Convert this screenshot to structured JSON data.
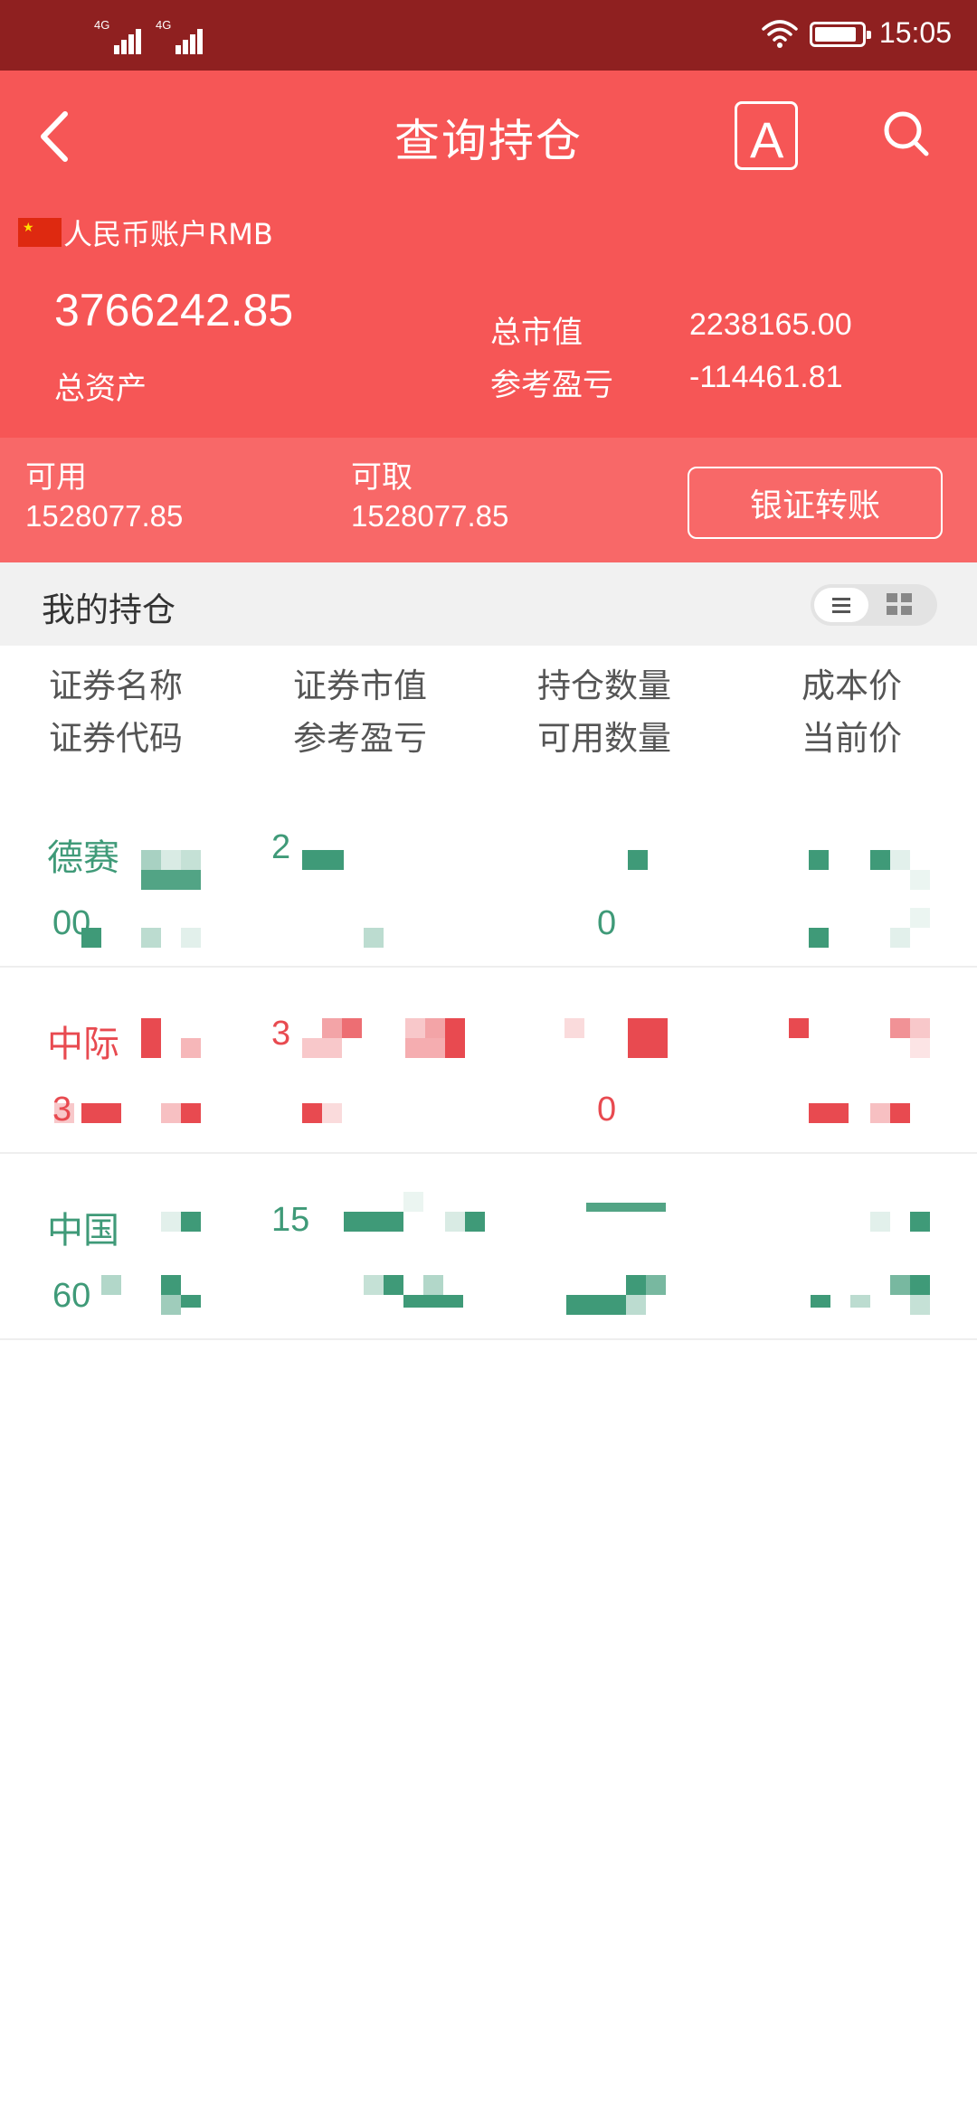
{
  "status_bar": {
    "network_1": "4G",
    "network_2": "4G",
    "time": "15:05"
  },
  "header": {
    "title": "查询持仓",
    "font_button_glyph": "A"
  },
  "account": {
    "label": "人民币账户RMB",
    "total_assets_value": "3766242.85",
    "total_assets_label": "总资产",
    "market_value_label": "总市值",
    "market_value": "2238165.00",
    "ref_pl_label": "参考盈亏",
    "ref_pl": "-114461.81"
  },
  "funds": {
    "available_label": "可用",
    "available_value": "1528077.85",
    "withdrawable_label": "可取",
    "withdrawable_value": "1528077.85",
    "transfer_button": "银证转账"
  },
  "holdings_section": {
    "title": "我的持仓"
  },
  "columns": {
    "name": "证券名称",
    "code": "证券代码",
    "market_value": "证券市值",
    "ref_pl": "参考盈亏",
    "position_qty": "持仓数量",
    "available_qty": "可用数量",
    "cost_price": "成本价",
    "current_price": "当前价"
  },
  "colors": {
    "header_red": "#f65656",
    "status_bar": "#8f2020",
    "gain_red": "#e84a50",
    "loss_green": "#3f9a78"
  },
  "holdings": [
    {
      "name": "德赛",
      "code": "00",
      "market_value": "2",
      "ref_pl": "",
      "position_qty": "",
      "available_qty": "0",
      "cost_price": "",
      "current_price": "",
      "trend": "loss"
    },
    {
      "name": "中际",
      "code": "3",
      "market_value": "3",
      "ref_pl": "",
      "position_qty": "",
      "available_qty": "0",
      "cost_price": "",
      "current_price": "",
      "trend": "gain"
    },
    {
      "name": "中国",
      "code": "60",
      "market_value": "15",
      "ref_pl": "",
      "position_qty": "",
      "available_qty": "",
      "cost_price": "",
      "current_price": "",
      "trend": "loss"
    }
  ]
}
